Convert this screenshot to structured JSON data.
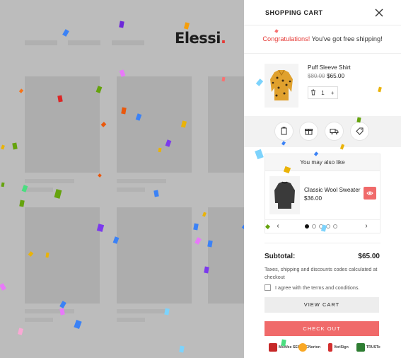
{
  "backdrop": {
    "logo_text": "Elessi",
    "logo_dot": "."
  },
  "cart": {
    "title": "SHOPPING CART",
    "close_icon": "close-icon",
    "shipping": {
      "congrats": "Congratulations!",
      "message": " You've got free shipping!"
    },
    "item": {
      "name": "Puff Sleeve Shirt",
      "old_price": "$80.00",
      "price": "$65.00",
      "quantity": "1",
      "minus": "−",
      "plus": "+"
    },
    "tools": [
      "note-icon",
      "gift-icon",
      "shipping-truck-icon",
      "coupon-tag-icon"
    ],
    "upsell": {
      "title": "You may also like",
      "product_name": "Classic Wool Sweater",
      "product_price": "$36.00",
      "prev": "‹",
      "next": "›",
      "pages": 5,
      "active_page": 1
    },
    "subtotal_label": "Subtotal:",
    "subtotal_value": "$65.00",
    "tax_note": "Taxes, shipping and discounts codes calculated at checkout",
    "terms_text": "I agree with the terms and conditions.",
    "view_cart": "VIEW CART",
    "checkout": "CHECK OUT",
    "trust_badges": [
      {
        "name": "McAfee SECURE",
        "color": "#c62828"
      },
      {
        "name": "Norton",
        "color": "#f9a825"
      },
      {
        "name": "VeriSign",
        "color": "#d32f2f"
      },
      {
        "name": "TRUSTe",
        "color": "#2e7d32"
      }
    ],
    "accent_color": "#f06a6a",
    "warning_color": "#e53935"
  }
}
